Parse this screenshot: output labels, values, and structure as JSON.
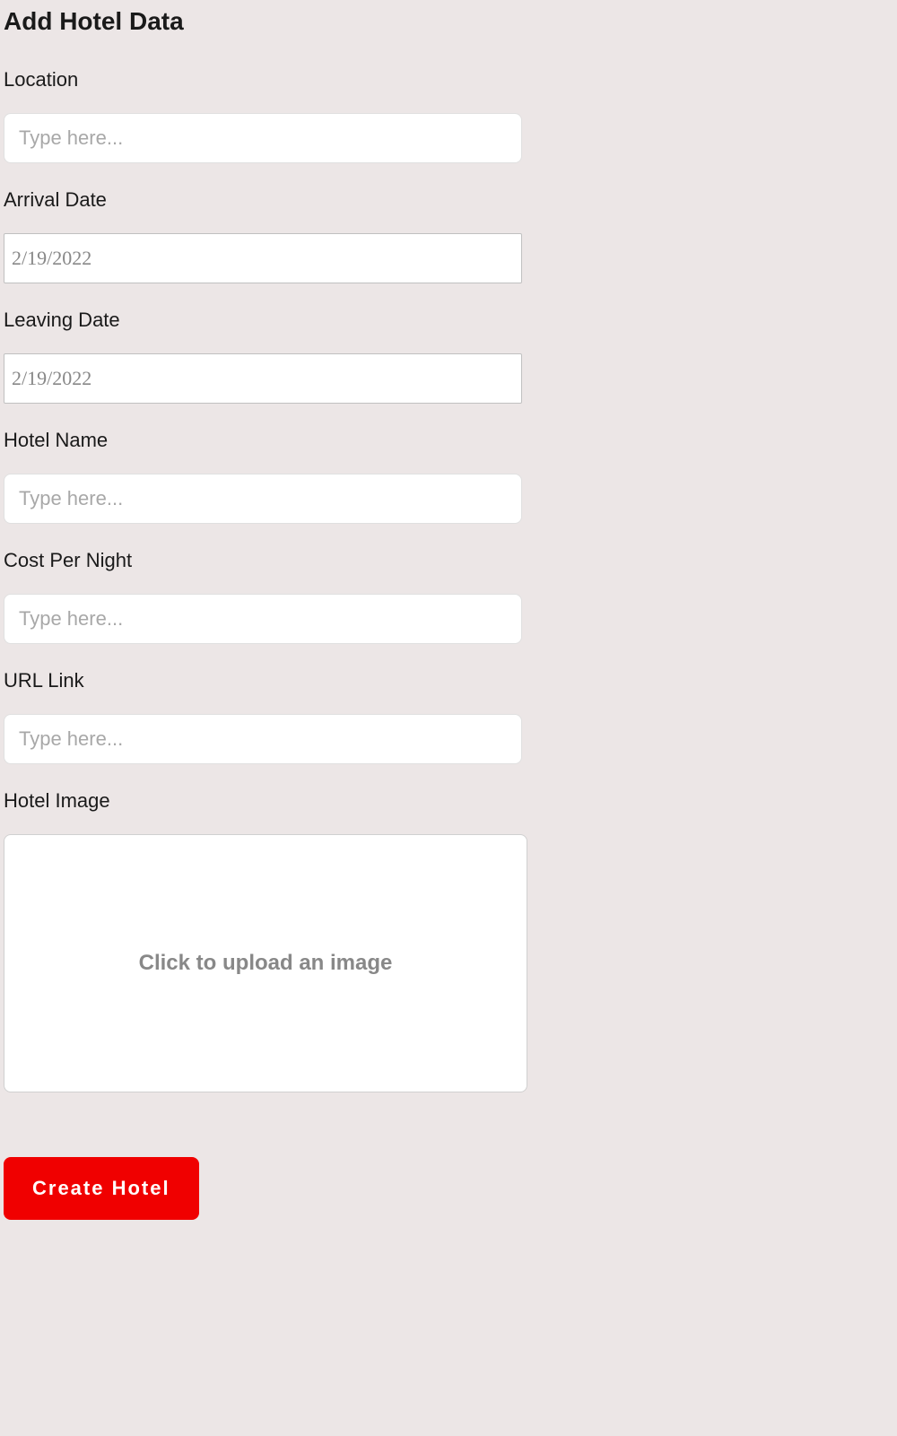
{
  "title": "Add Hotel Data",
  "fields": {
    "location": {
      "label": "Location",
      "placeholder": "Type here..."
    },
    "arrival": {
      "label": "Arrival Date",
      "placeholder": "2/19/2022"
    },
    "leaving": {
      "label": "Leaving Date",
      "placeholder": "2/19/2022"
    },
    "hotelName": {
      "label": "Hotel Name",
      "placeholder": "Type here..."
    },
    "cost": {
      "label": "Cost Per Night",
      "placeholder": "Type here..."
    },
    "url": {
      "label": "URL Link",
      "placeholder": "Type here..."
    },
    "image": {
      "label": "Hotel Image",
      "uploadText": "Click to upload an image"
    }
  },
  "submitLabel": "Create Hotel"
}
